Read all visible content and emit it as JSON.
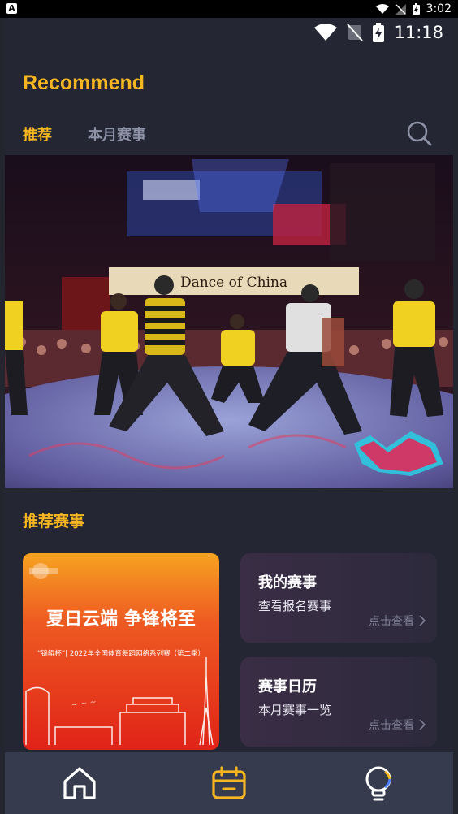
{
  "system_bar": {
    "time": "3:02"
  },
  "status_bar": {
    "time": "11:18"
  },
  "header": {
    "title": "Recommend"
  },
  "tabs": [
    {
      "label": "推荐"
    },
    {
      "label": "本月赛事"
    }
  ],
  "banner": {
    "sign_text": "Dance of China"
  },
  "section": {
    "title": "推荐赛事"
  },
  "poster": {
    "headline": "夏日云端 争锋将至",
    "subtitle": "“锦鲲杯”| 2022年全国体育舞蹈网络系列赛（第二季）"
  },
  "cards": [
    {
      "title": "我的赛事",
      "subtitle": "查看报名赛事",
      "link": "点击查看"
    },
    {
      "title": "赛事日历",
      "subtitle": "本月赛事一览",
      "link": "点击查看"
    }
  ],
  "colors": {
    "accent": "#f5b622",
    "background": "#242733",
    "nav": "#363b4d"
  },
  "icons": [
    "search-icon",
    "home-icon",
    "calendar-icon",
    "bulb-icon",
    "wifi-icon",
    "battery-icon",
    "chevron-right-icon"
  ]
}
